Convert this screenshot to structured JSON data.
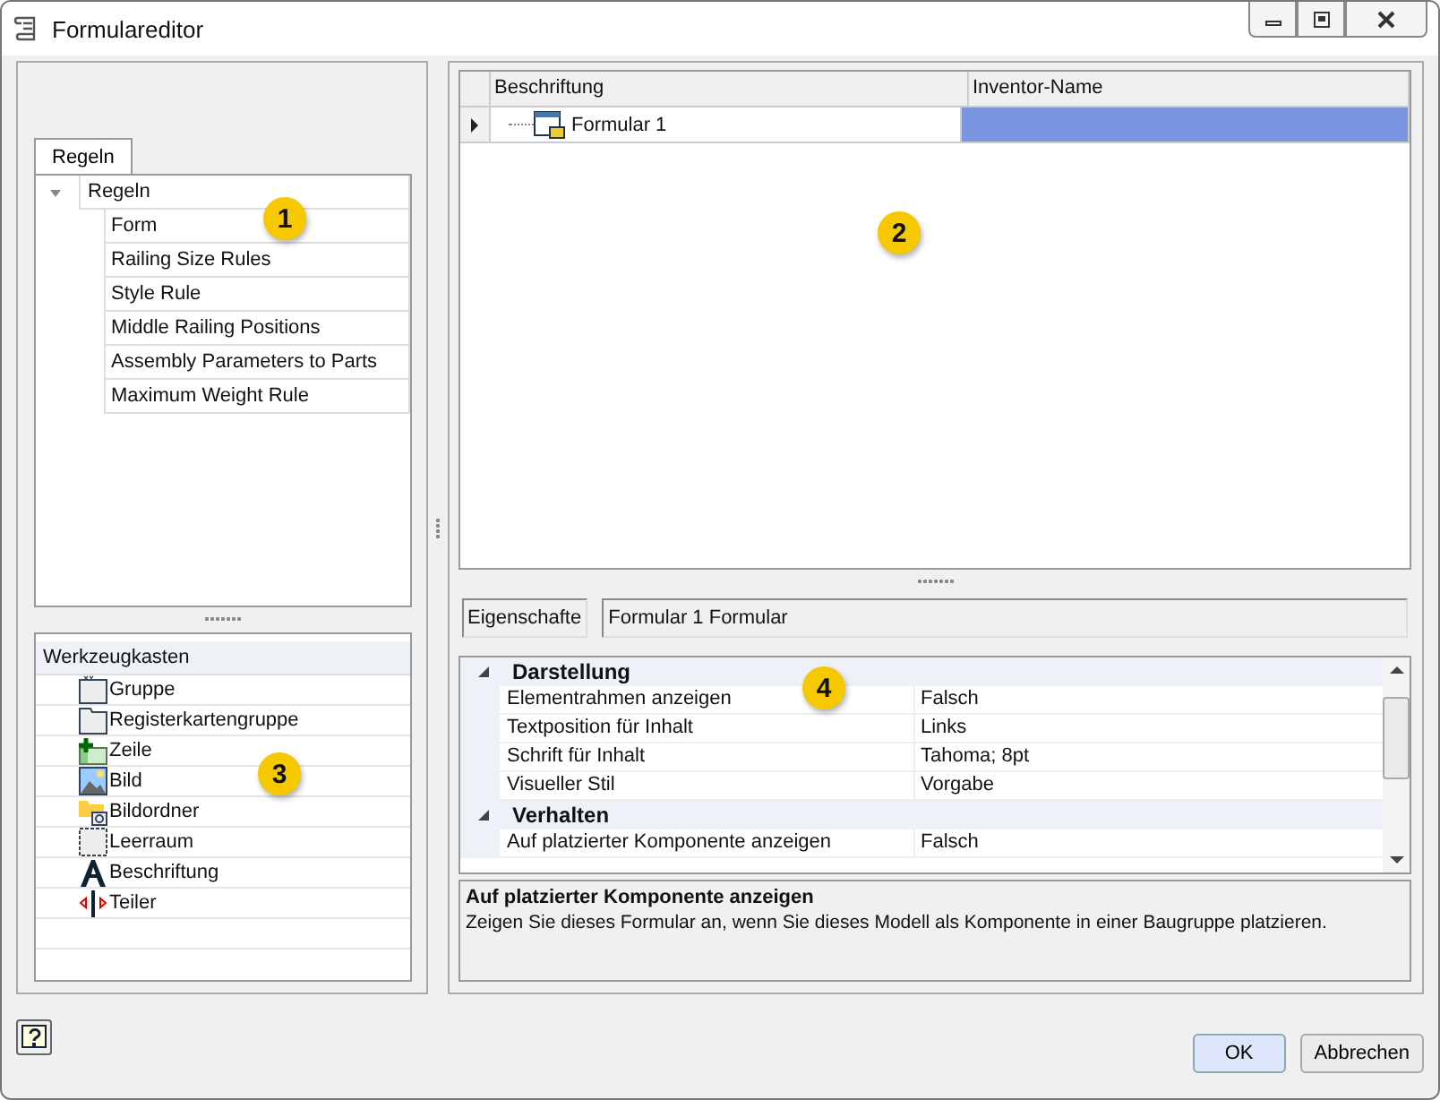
{
  "window": {
    "title": "Formulareditor"
  },
  "rules_tab": {
    "label": "Regeln",
    "selected": true
  },
  "rules_tree": {
    "label": "Regeln",
    "expanded": true,
    "children": [
      {
        "label": "Form"
      },
      {
        "label": "Railing Size Rules"
      },
      {
        "label": "Style Rule"
      },
      {
        "label": "Middle Railing Positions"
      },
      {
        "label": "Assembly Parameters to Parts"
      },
      {
        "label": "Maximum Weight Rule"
      }
    ]
  },
  "toolbox": {
    "title": "Werkzeugkasten",
    "items": [
      {
        "label": "Gruppe",
        "kind": "group"
      },
      {
        "label": "Registerkartengruppe",
        "kind": "tabgroup"
      },
      {
        "label": "Zeile",
        "kind": "row"
      },
      {
        "label": "Bild",
        "kind": "picture"
      },
      {
        "label": "Bildordner",
        "kind": "folder"
      },
      {
        "label": "Leerraum",
        "kind": "space"
      },
      {
        "label": "Beschriftung",
        "kind": "label"
      },
      {
        "label": "Teiler",
        "kind": "splitter"
      }
    ]
  },
  "form_grid": {
    "columns": [
      "Beschriftung",
      "Inventor-Name"
    ],
    "rows": [
      {
        "label": "Formular 1",
        "selected": true
      }
    ]
  },
  "properties_header": {
    "tab": "Eigenschafte",
    "value": "Formular  1 Formular"
  },
  "property_grid": {
    "categories": [
      {
        "name": "Darstellung",
        "expanded": true,
        "rows": [
          {
            "name": "Elementrahmen anzeigen",
            "value": "Falsch"
          },
          {
            "name": "Textposition für Inhalt",
            "value": "Links"
          },
          {
            "name": "Schrift für Inhalt",
            "value": "Tahoma; 8pt"
          },
          {
            "name": "Visueller Stil",
            "value": "Vorgabe"
          }
        ]
      },
      {
        "name": "Verhalten",
        "expanded": true,
        "rows": [
          {
            "name": "Auf platzierter Komponente anzeigen",
            "value": "Falsch"
          }
        ]
      }
    ]
  },
  "description": {
    "title": "Auf platzierter Komponente anzeigen",
    "text": "Zeigen Sie dieses Formular an, wenn Sie dieses Modell als Komponente in einer Baugruppe platzieren."
  },
  "buttons": {
    "ok": "OK",
    "cancel": "Abbrechen"
  },
  "callouts": [
    "1",
    "2",
    "3",
    "4"
  ]
}
